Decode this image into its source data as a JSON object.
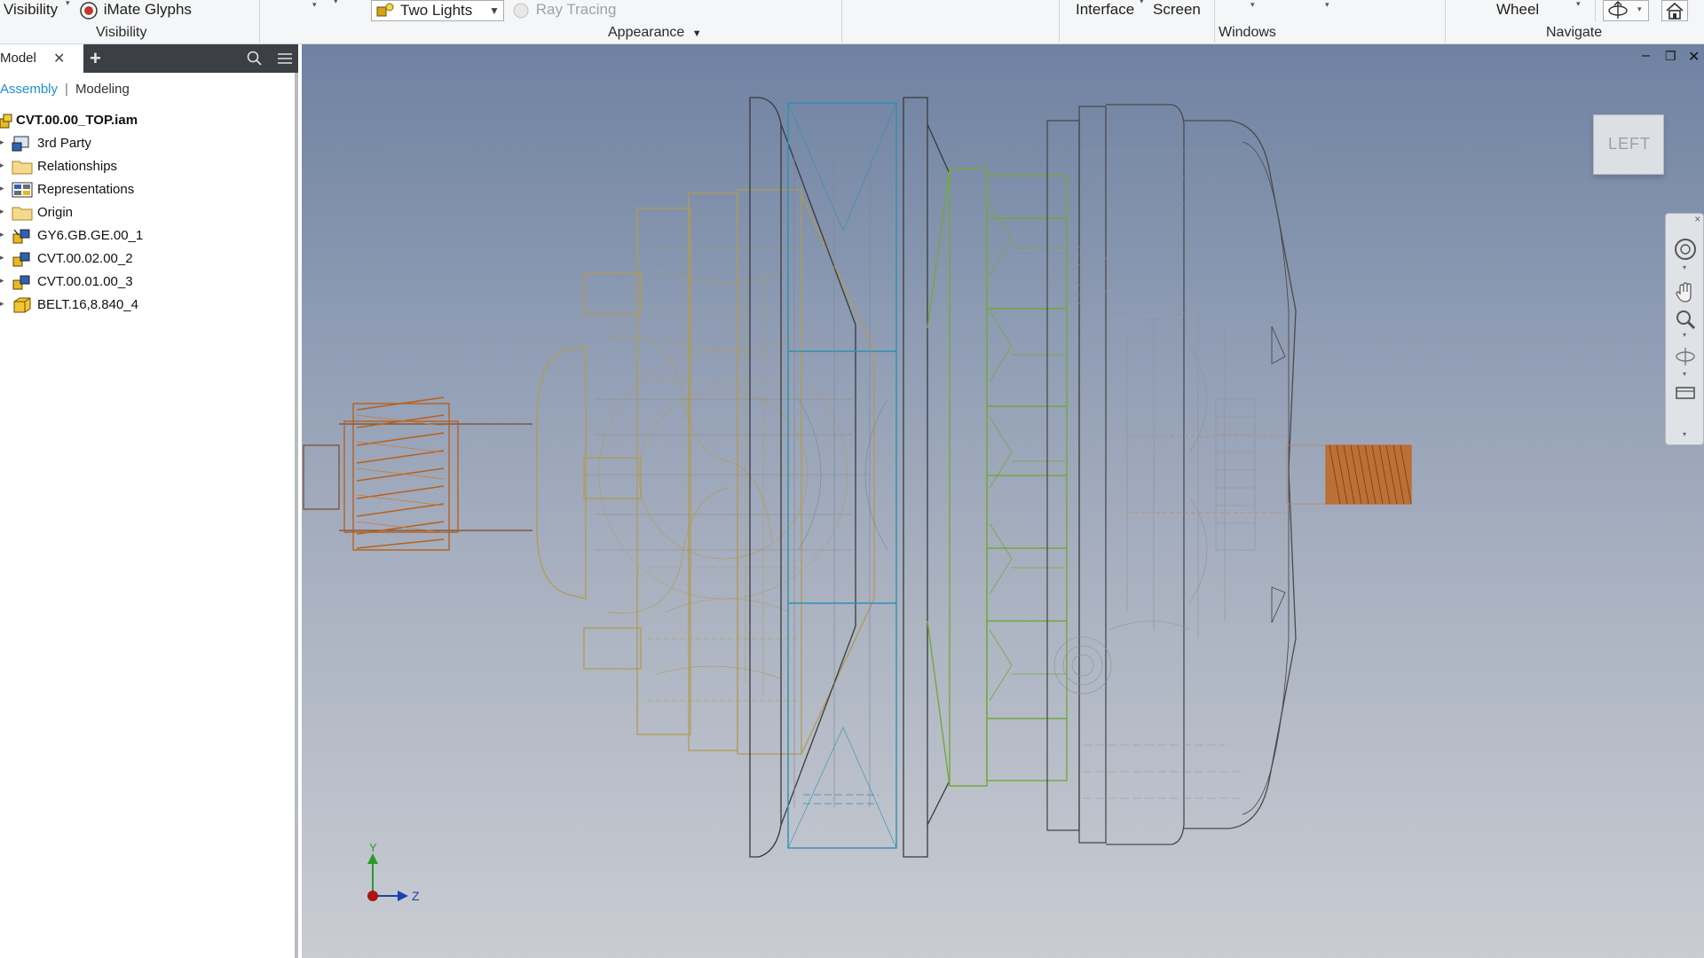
{
  "ribbon": {
    "visibility_button": "Visibility",
    "imate_glyphs": "iMate Glyphs",
    "visibility_group": "Visibility",
    "lighting_value": "Two Lights",
    "ray_tracing": "Ray Tracing",
    "appearance_group": "Appearance",
    "user_interface_button": "Interface",
    "full_screen_button": "Screen",
    "windows_group": "Windows",
    "steering_wheel_button": "Wheel",
    "navigate_group": "Navigate"
  },
  "panel": {
    "tab_label": "Model",
    "mode_assembly": "Assembly",
    "mode_modeling": "Modeling",
    "root": "CVT.00.00_TOP.iam",
    "items": [
      {
        "label": "3rd Party",
        "icon": "third-party-icon"
      },
      {
        "label": "Relationships",
        "icon": "folder-icon"
      },
      {
        "label": "Representations",
        "icon": "representations-icon"
      },
      {
        "label": "Origin",
        "icon": "folder-icon"
      },
      {
        "label": "GY6.GB.GE.00_1",
        "icon": "subassembly-icon"
      },
      {
        "label": "CVT.00.02.00_2",
        "icon": "subassembly-icon"
      },
      {
        "label": "CVT.00.01.00_3",
        "icon": "subassembly-icon"
      },
      {
        "label": "BELT.16,8.840_4",
        "icon": "part-icon"
      }
    ]
  },
  "viewport": {
    "viewcube_face": "LEFT",
    "axis_y": "Y",
    "axis_z": "Z",
    "render_style": "wireframe"
  },
  "colors": {
    "accent_link": "#1f8fd6",
    "gear_orange": "#b8601c",
    "clutch_tan": "#b39a55",
    "belt_blue": "#2e8fb0",
    "pulley_green": "#74a83a",
    "housing_gray": "#4a4a4a"
  }
}
